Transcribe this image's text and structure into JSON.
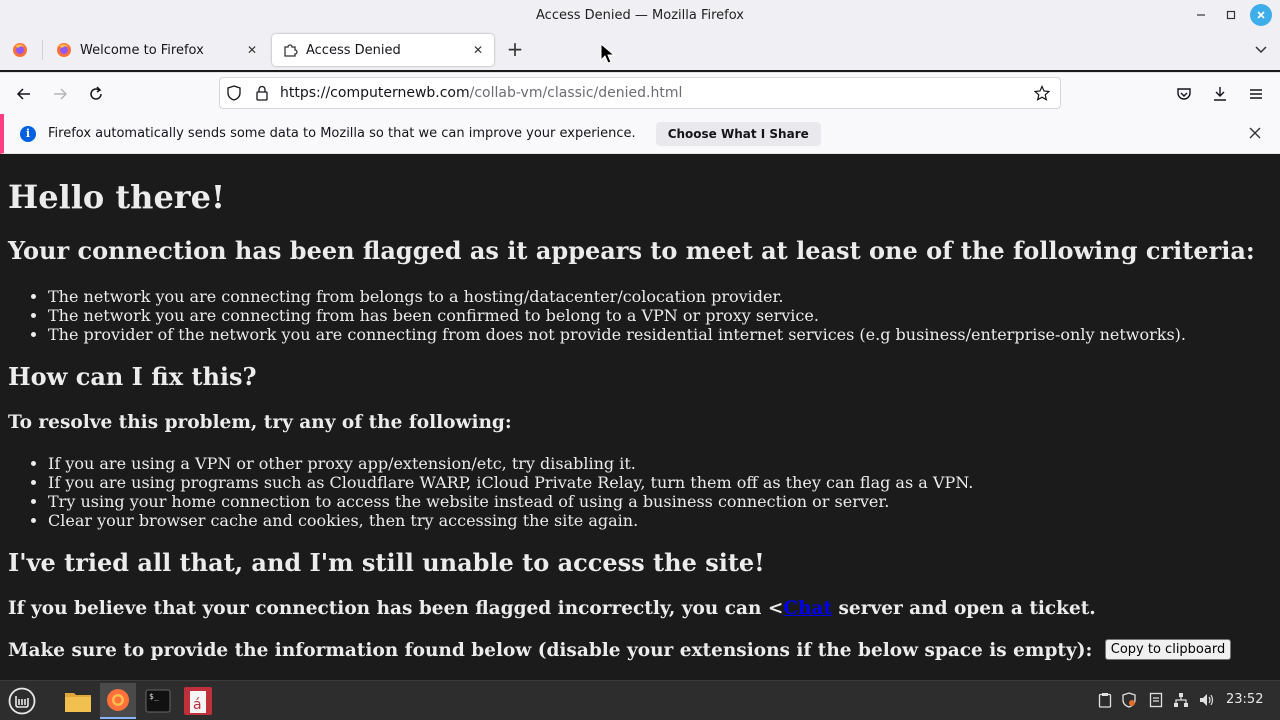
{
  "window": {
    "title": "Access Denied — Mozilla Firefox"
  },
  "tabs": [
    {
      "label": "Welcome to Firefox",
      "icon": "firefox-icon"
    },
    {
      "label": "Access Denied",
      "icon": "puzzle-icon",
      "active": true
    }
  ],
  "navbar": {
    "url_host": "https://computernewb.com",
    "url_path": "/collab-vm/classic/denied.html"
  },
  "notification": {
    "message": "Firefox automatically sends some data to Mozilla so that we can improve your experience.",
    "button_label": "Choose What I Share"
  },
  "page": {
    "heading": "Hello there!",
    "flagged_heading": "Your connection has been flagged as it appears to meet at least one of the following criteria:",
    "criteria": [
      "The network you are connecting from belongs to a hosting/datacenter/colocation provider.",
      "The network you are connecting from has been confirmed to belong to a VPN or proxy service.",
      "The provider of the network you are connecting from does not provide residential internet services (e.g business/enterprise-only networks)."
    ],
    "fix_heading": "How can I fix this?",
    "resolve_heading": "To resolve this problem, try any of the following:",
    "steps": [
      "If you are using a VPN or other proxy app/extension/etc, try disabling it.",
      "If you are using programs such as Cloudflare WARP, iCloud Private Relay, turn them off as they can flag as a VPN.",
      "Try using your home connection to access the website instead of using a business connection or server.",
      "Clear your browser cache and cookies, then try accessing the site again."
    ],
    "still_heading": "I've tried all that, and I'm still unable to access the site!",
    "incorrect_prefix": "If you believe that your connection has been flagged incorrectly, you can <",
    "chat_link": "Chat",
    "incorrect_suffix": " server and open a ticket.",
    "info_text": "Make sure to provide the information found below (disable your extensions if the below space is empty):",
    "copy_button": "Copy to clipboard"
  },
  "taskbar": {
    "clock": "23:52",
    "apps": [
      "files-icon",
      "firefox-icon",
      "terminal-icon",
      "input-method-icon"
    ]
  },
  "colors": {
    "page_bg": "#1b1b1b",
    "link": "#0000ee",
    "notification_accent": "#ff3f7f",
    "close_accent": "#3daee9"
  }
}
